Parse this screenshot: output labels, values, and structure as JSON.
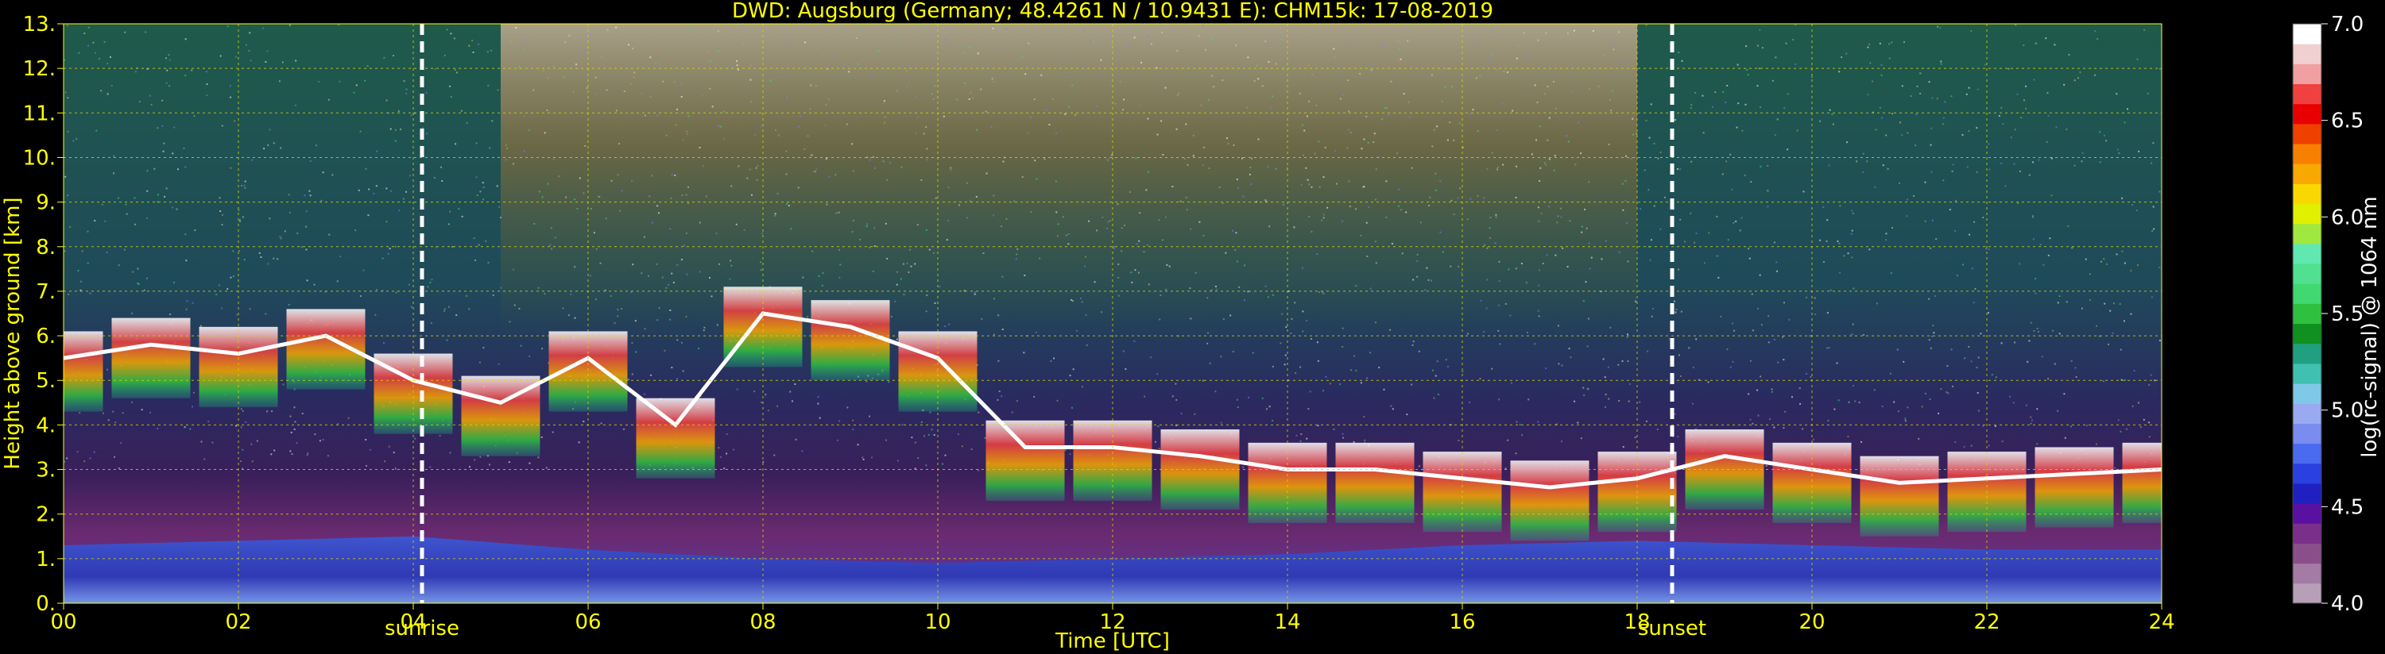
{
  "chart_data": {
    "type": "heatmap",
    "title": "DWD: Augsburg (Germany; 48.4261 N / 10.9431 E):    CHM15k: 17-08-2019",
    "xlabel": "Time [UTC]",
    "ylabel": "Height above ground [km]",
    "xlim": [
      0,
      24
    ],
    "ylim": [
      0,
      13
    ],
    "x_ticks": [
      "00",
      "02",
      "04",
      "06",
      "08",
      "10",
      "12",
      "14",
      "16",
      "18",
      "20",
      "22",
      "24"
    ],
    "y_ticks": [
      "0.",
      "1.",
      "2.",
      "3.",
      "4.",
      "5.",
      "6.",
      "7.",
      "8.",
      "9.",
      "10.",
      "11.",
      "12.",
      "13."
    ],
    "grid": true,
    "events": [
      {
        "label": "sunrise",
        "time": 4.1
      },
      {
        "label": "sunset",
        "time": 18.4
      }
    ],
    "colorbar": {
      "label": "log(rc-signal) @ 1064 nm",
      "range": [
        4.0,
        7.0
      ],
      "ticks": [
        "4.0",
        "4.5",
        "5.0",
        "5.5",
        "6.0",
        "6.5",
        "7.0"
      ],
      "colors": [
        "#b7a0b7",
        "#a47ba4",
        "#8a4f8a",
        "#7a2f8a",
        "#5a10a0",
        "#2020c0",
        "#2a40e0",
        "#4a6af0",
        "#7a8cf0",
        "#9aaaf0",
        "#80c8e8",
        "#40c0b0",
        "#20a080",
        "#109020",
        "#30c040",
        "#40d870",
        "#50e090",
        "#60e8b0",
        "#a0e840",
        "#e0f000",
        "#f8d800",
        "#f8a800",
        "#f88000",
        "#f04000",
        "#e80000",
        "#f04040",
        "#f0a0a0",
        "#f0d0d0",
        "#ffffff"
      ]
    },
    "layers": [
      {
        "name": "boundary layer",
        "values": [
          [
            0,
            1.3
          ],
          [
            2,
            1.4
          ],
          [
            4,
            1.5
          ],
          [
            6,
            1.2
          ],
          [
            8,
            1.0
          ],
          [
            10,
            0.9
          ],
          [
            12,
            1.0
          ],
          [
            14,
            1.1
          ],
          [
            16,
            1.3
          ],
          [
            18,
            1.4
          ],
          [
            20,
            1.3
          ],
          [
            22,
            1.2
          ],
          [
            24,
            1.2
          ]
        ]
      },
      {
        "name": "cloud base",
        "values": [
          [
            0,
            5.5
          ],
          [
            1,
            5.8
          ],
          [
            2,
            5.6
          ],
          [
            3,
            6.0
          ],
          [
            4,
            5.0
          ],
          [
            5,
            4.5
          ],
          [
            6,
            5.5
          ],
          [
            7,
            4.0
          ],
          [
            8,
            6.5
          ],
          [
            9,
            6.2
          ],
          [
            10,
            5.5
          ],
          [
            11,
            3.5
          ],
          [
            12,
            3.5
          ],
          [
            13,
            3.3
          ],
          [
            14,
            3.0
          ],
          [
            15,
            3.0
          ],
          [
            16,
            2.8
          ],
          [
            17,
            2.6
          ],
          [
            18,
            2.8
          ],
          [
            19,
            3.3
          ],
          [
            20,
            3.0
          ],
          [
            21,
            2.7
          ],
          [
            22,
            2.8
          ],
          [
            23,
            2.9
          ],
          [
            24,
            3.0
          ]
        ]
      }
    ]
  }
}
